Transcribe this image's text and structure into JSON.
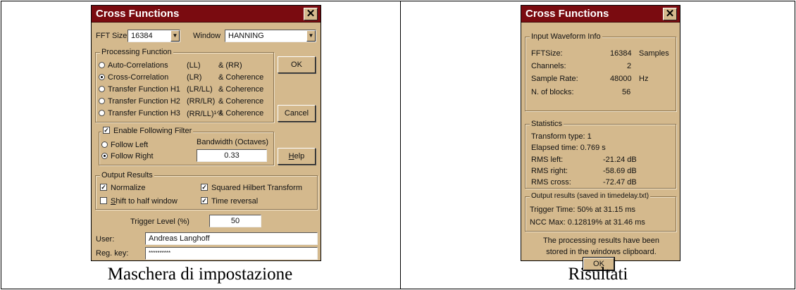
{
  "left_dialog": {
    "title": "Cross Functions",
    "close_glyph": "✕",
    "fft_size_label": "FFT Size",
    "fft_size_value": "16384",
    "window_label": "Window",
    "window_value": "HANNING",
    "processing_group": "Processing Function",
    "functions": [
      {
        "name": "Auto-Correlations",
        "code": "(LL)",
        "extra": "& (RR)",
        "selected": false
      },
      {
        "name": "Cross-Correlation",
        "code": "(LR)",
        "extra": "& Coherence",
        "selected": true
      },
      {
        "name": "Transfer Function H1",
        "code": "(LR/LL)",
        "extra": "& Coherence",
        "selected": false
      },
      {
        "name": "Transfer Function H2",
        "code": "(RR/LR)",
        "extra": "& Coherence",
        "selected": false
      },
      {
        "name": "Transfer Function H3",
        "code": "(RR/LL)¹ᐟ²",
        "extra": "& Coherence",
        "selected": false
      }
    ],
    "ok_label": "OK",
    "cancel_label": "Cancel",
    "help_label": "Help",
    "filter_label": "Enable Following Filter",
    "follow_left": "Follow Left",
    "follow_right": "Follow Right",
    "bandwidth_label": "Bandwidth (Octaves)",
    "bandwidth_value": "0.33",
    "output_group": "Output Results",
    "normalize": "Normalize",
    "shift_half": "Shift to half window",
    "squared_hilbert": "Squared Hilbert Transform",
    "time_reversal": "Time reversal",
    "trigger_label": "Trigger Level (%)",
    "trigger_value": "50",
    "user_label": "User:",
    "user_value": "Andreas Langhoff",
    "regkey_label": "Reg. key:",
    "regkey_value": "**********"
  },
  "right_dialog": {
    "title": "Cross Functions",
    "close_glyph": "✕",
    "input_group": "Input Waveform Info",
    "fftsize_label": "FFTSize:",
    "fftsize_value": "16384",
    "fftsize_unit": "Samples",
    "channels_label": "Channels:",
    "channels_value": "2",
    "sample_rate_label": "Sample Rate:",
    "sample_rate_value": "48000",
    "sample_rate_unit": "Hz",
    "blocks_label": "N. of blocks:",
    "blocks_value": "56",
    "stats_group": "Statistics",
    "transform_type": "Transform type: 1",
    "elapsed": "Elapsed time: 0.769 s",
    "rms_left_label": "RMS left:",
    "rms_left_value": "-21.24 dB",
    "rms_right_label": "RMS right:",
    "rms_right_value": "-58.69 dB",
    "rms_cross_label": "RMS cross:",
    "rms_cross_value": "-72.47 dB",
    "output_group": "Output results (saved in timedelay.txt)",
    "trigger_time": "Trigger Time: 50%  at 31.15 ms",
    "ncc_max": "NCC Max: 0.12819%  at 31.46 ms",
    "clipboard_line1": "The processing results have been",
    "clipboard_line2": "stored in the windows clipboard.",
    "ok_label": "OK"
  },
  "captions": {
    "left": "Maschera di impostazione",
    "right": "Risultati"
  }
}
